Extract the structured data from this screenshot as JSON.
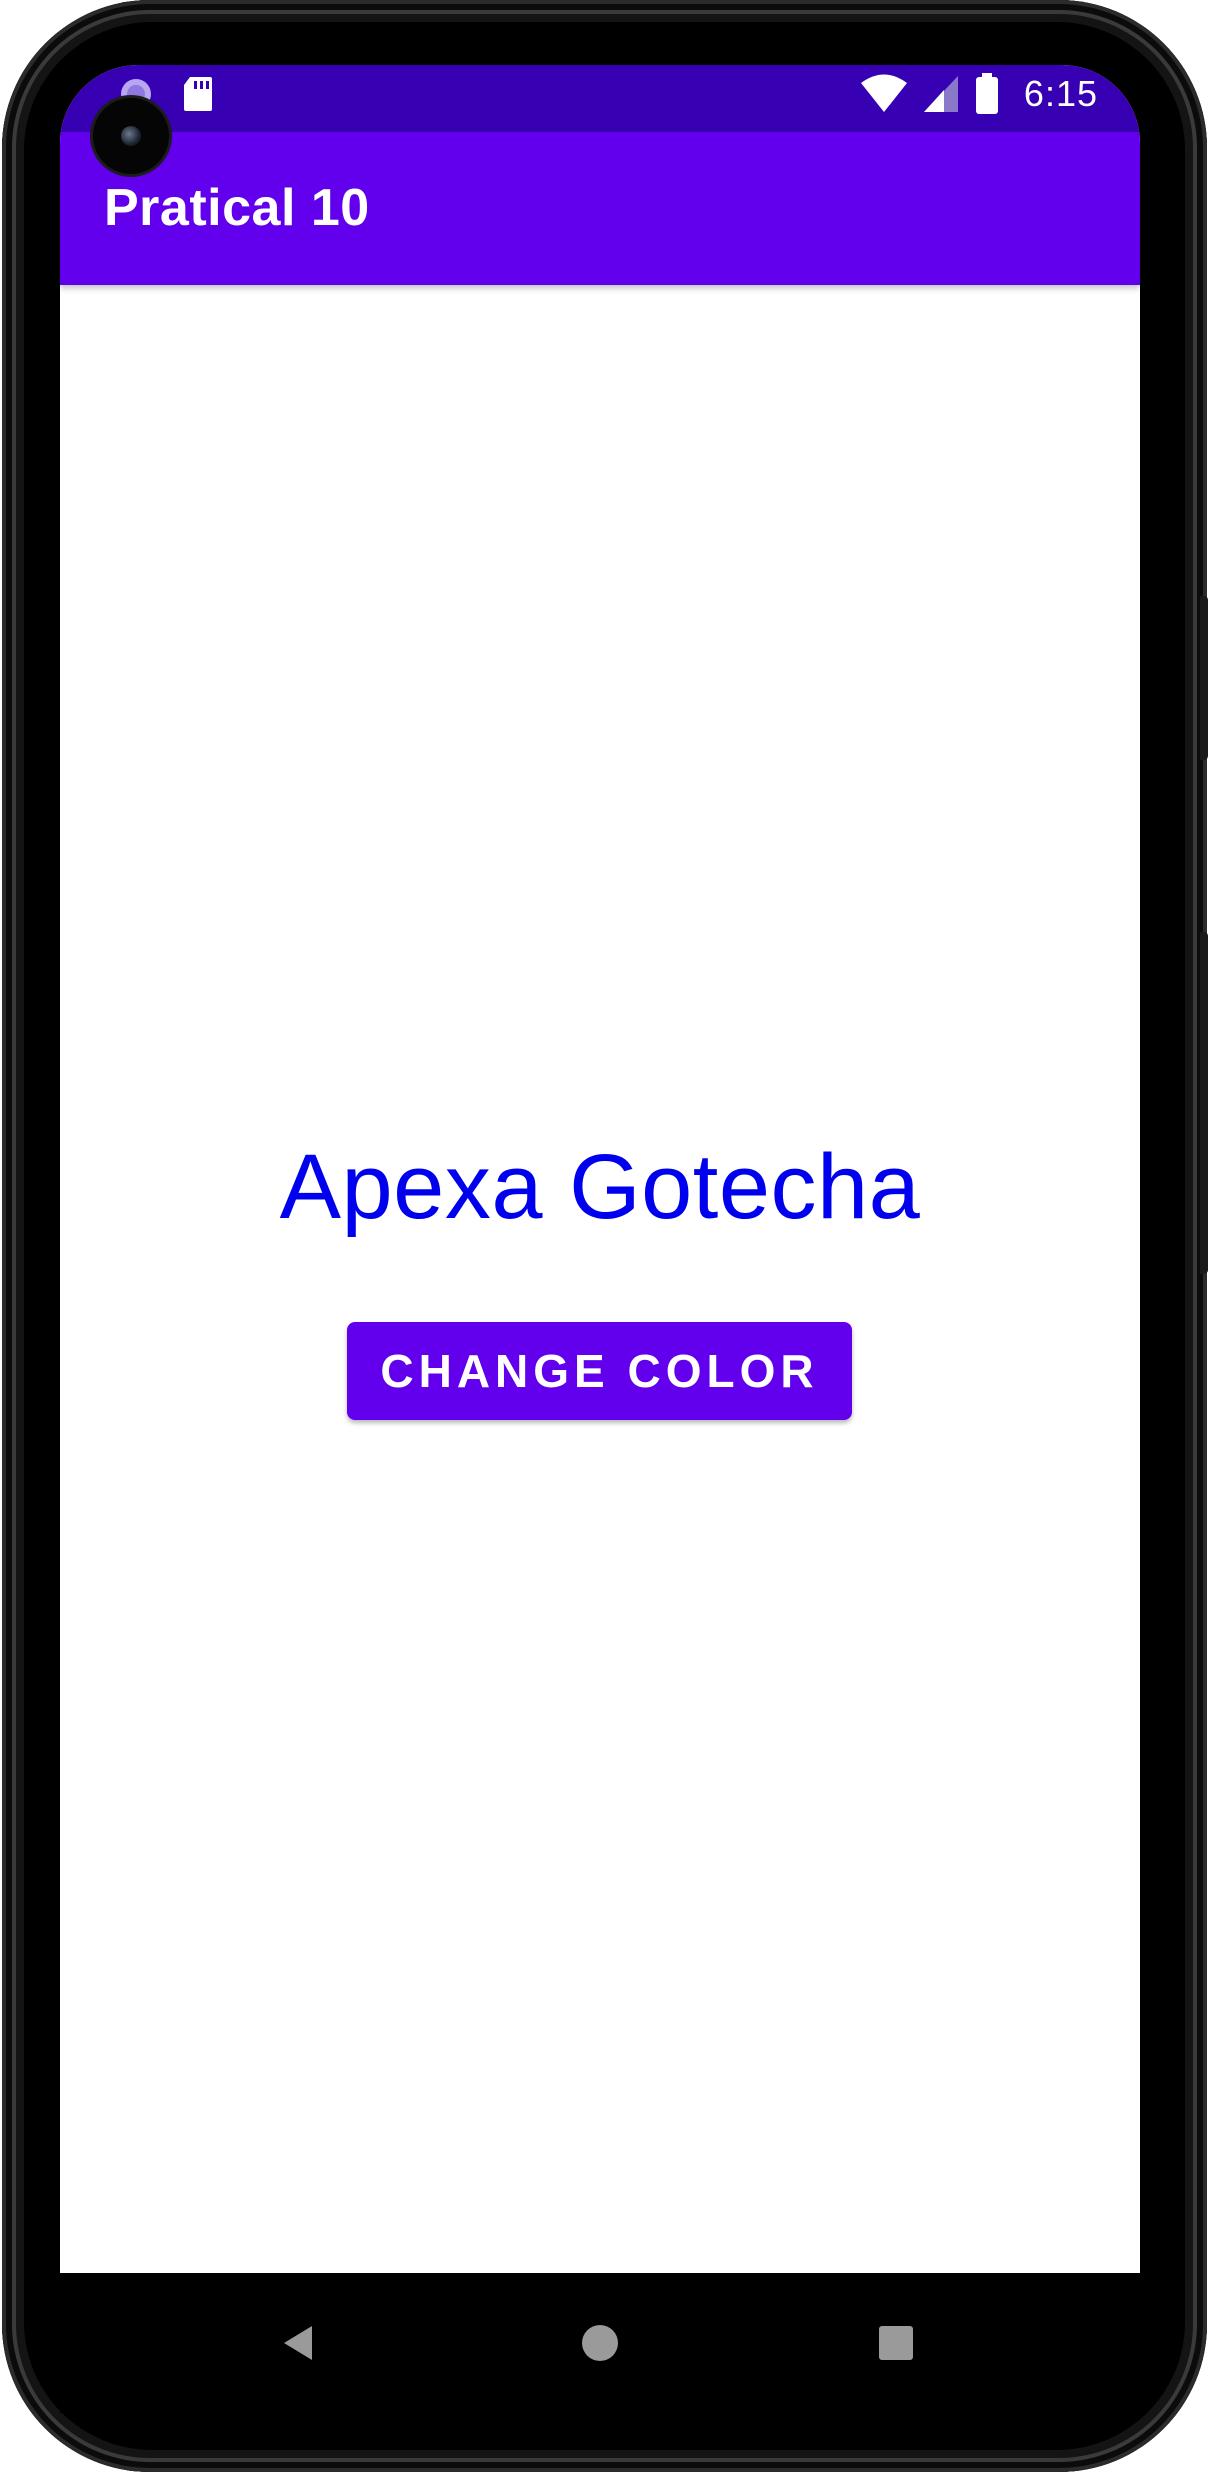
{
  "status_bar": {
    "time": "6:15",
    "icons": [
      "notification-icon",
      "sd-card-icon",
      "wifi-icon",
      "cell-signal-icon",
      "battery-icon"
    ]
  },
  "app_bar": {
    "title": "Pratical 10"
  },
  "main": {
    "name_text": "Apexa Gotecha",
    "change_color_label": "CHANGE COLOR"
  },
  "navigation": {
    "icons": [
      "back-icon",
      "home-icon",
      "recents-icon"
    ]
  },
  "colors": {
    "status_bar": "#3700b3",
    "app_bar": "#6200ee",
    "button": "#6200ee",
    "name_text": "#0000ee",
    "background": "#ffffff"
  }
}
